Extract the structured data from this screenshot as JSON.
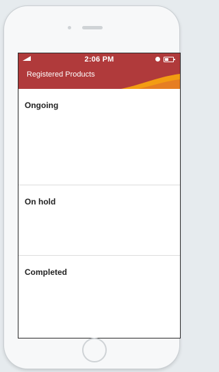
{
  "status_bar": {
    "time": "2:06 PM"
  },
  "header": {
    "title": "Registered Products"
  },
  "sections": [
    {
      "label": "Ongoing"
    },
    {
      "label": "On hold"
    },
    {
      "label": "Completed"
    }
  ],
  "colors": {
    "header": "#b03a3b",
    "accent_wave": "#f39c12",
    "accent_wave_dark": "#e67e22"
  }
}
